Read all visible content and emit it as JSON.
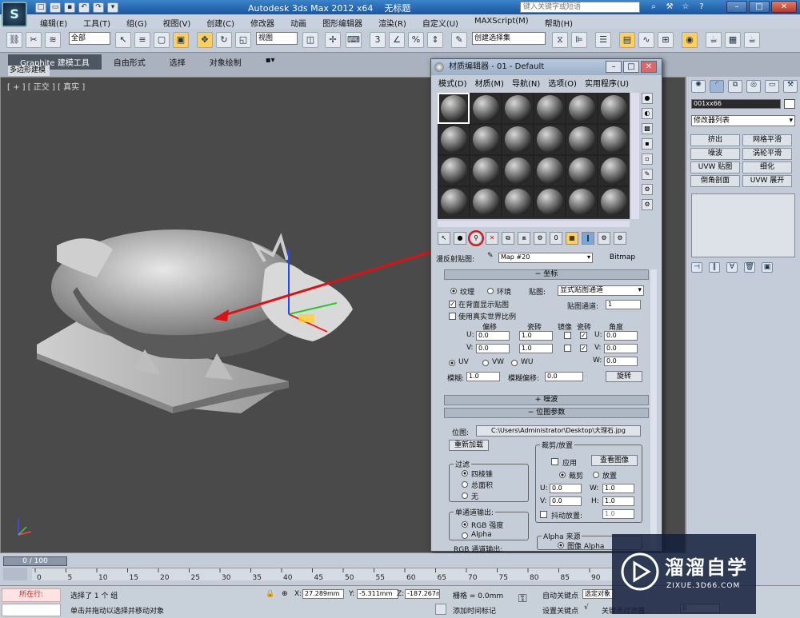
{
  "window": {
    "title": "Autodesk 3ds Max  2012 x64",
    "doc": "无标题",
    "search_placeholder": "键入关键字或短语"
  },
  "menus": [
    "编辑(E)",
    "工具(T)",
    "组(G)",
    "视图(V)",
    "创建(C)",
    "修改器",
    "动画",
    "图形编辑器",
    "渲染(R)",
    "自定义(U)",
    "MAXScript(M)",
    "帮助(H)"
  ],
  "toolbar": {
    "filter": "全部",
    "view": "视图",
    "named_selection": "创建选择集"
  },
  "ribbon": {
    "tabs": [
      "Graphite 建模工具",
      "自由形式",
      "选择",
      "对象绘制"
    ],
    "sub": "多边形建模"
  },
  "viewport": {
    "label": "[ + ] [ 正交 ] [ 真实 ]"
  },
  "cmdpanel": {
    "object_name": "001xx66",
    "modifier_list": "修改器列表",
    "buttons": [
      "挤出",
      "网格平滑",
      "噪波",
      "涡轮平滑",
      "UVW 贴图",
      "细化",
      "倒角剖面",
      "UVW 展开"
    ]
  },
  "material_editor": {
    "title": "材质编辑器 - 01 - Default",
    "menu": [
      "模式(D)",
      "材质(M)",
      "导航(N)",
      "选项(O)",
      "实用程序(U)"
    ],
    "map_label": "漫反射贴图:",
    "map_name": "Map #20",
    "map_type": "Bitmap",
    "coords": {
      "title": "坐标",
      "texture": "纹理",
      "env": "环境",
      "mapping_lbl": "贴图:",
      "mapping": "显式贴图通道",
      "show_back": "在背面显示贴图",
      "channel_lbl": "贴图通道:",
      "channel": "1",
      "real_world": "使用真实世界比例",
      "offset": "偏移",
      "tiling": "瓷砖",
      "mirror": "镜像",
      "tile": "瓷砖",
      "angle": "角度",
      "u": "U:",
      "v": "V:",
      "w": "W:",
      "u_off": "0.0",
      "v_off": "0.0",
      "u_tile": "1.0",
      "v_tile": "1.0",
      "u_ang": "0.0",
      "v_ang": "0.0",
      "w_ang": "0.0",
      "uv": "UV",
      "vw": "VW",
      "wu": "WU",
      "blur_lbl": "模糊:",
      "blur": "1.0",
      "blur_off_lbl": "模糊偏移:",
      "blur_off": "0.0",
      "rotate": "旋转"
    },
    "noise_title": "噪波",
    "bitmap_title": "位图参数",
    "bitmap": {
      "path_lbl": "位图:",
      "path": "C:\\Users\\Administrator\\Desktop\\大理石.jpg",
      "reload": "重新加载",
      "crop_group": "裁剪/放置",
      "apply": "应用",
      "view_image": "查看图像",
      "crop": "裁剪",
      "place": "放置",
      "u": "U:",
      "v": "V:",
      "w": "W:",
      "h": "H:",
      "u_val": "0.0",
      "v_val": "0.0",
      "w_val": "1.0",
      "h_val": "1.0",
      "jitter_lbl": "抖动放置:",
      "jitter": "1.0",
      "filter_group": "过滤",
      "f1": "四棱锥",
      "f2": "总面积",
      "f3": "无",
      "mono_group": "单通道输出:",
      "m1": "RGB 强度",
      "m2": "Alpha",
      "alpha_group": "Alpha 来源",
      "a1": "图像 Alpha",
      "rgb_group": "RGB 通道输出:"
    }
  },
  "timeline": {
    "frame": "0 / 100",
    "ticks": [
      "0",
      "5",
      "10",
      "15",
      "20",
      "25",
      "30",
      "35",
      "40",
      "45",
      "50",
      "55",
      "60",
      "65",
      "70",
      "75",
      "80",
      "85",
      "90"
    ]
  },
  "status": {
    "running": "所在行:",
    "selected": "选择了 1 个 组",
    "hint": "单击并拖动以选择并移动对象",
    "x": "27.289mm",
    "y": "-5.311mm",
    "z": "-187.267m",
    "grid": "栅格 = 0.0mm",
    "autokey": "自动关键点",
    "set_key": "设置关键点",
    "key_filter": "关键点过滤器...",
    "add_tag": "添加时间标记",
    "sel_obj": "选定对象",
    "frame_val": "0"
  },
  "watermark": {
    "brand": "溜溜自学",
    "url": "ZIXUE.3D66.COM"
  }
}
